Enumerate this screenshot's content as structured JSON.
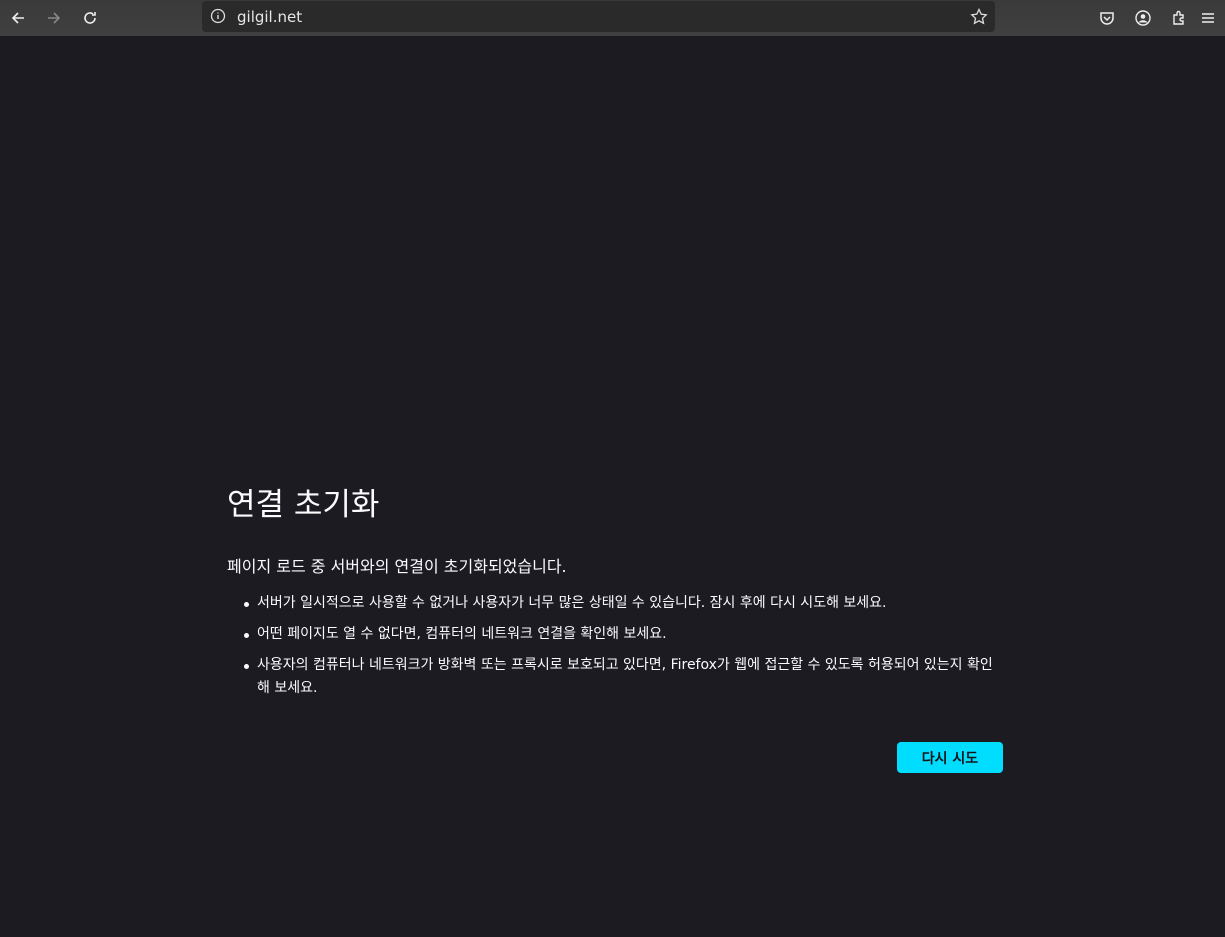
{
  "browser": {
    "url": "gilgil.net",
    "icons": [
      "back-icon",
      "forward-icon",
      "reload-icon",
      "info-icon",
      "star-icon",
      "pocket-icon",
      "account-icon",
      "extensions-icon",
      "menu-icon"
    ]
  },
  "error": {
    "title": "연결 초기화",
    "intro": "페이지 로드 중 서버와의 연결이 초기화되었습니다.",
    "bullets": [
      "서버가 일시적으로 사용할 수 없거나 사용자가 너무 많은 상태일 수 있습니다. 잠시 후에 다시 시도해 보세요.",
      "어떤 페이지도 열 수 없다면, 컴퓨터의 네트워크 연결을 확인해 보세요.",
      "사용자의 컴퓨터나 네트워크가 방화벽 또는 프록시로 보호되고 있다면, Firefox가 웹에 접근할 수 있도록 허용되어 있는지 확인해 보세요."
    ],
    "retry_label": "다시 시도",
    "accent": "#00ddff"
  }
}
